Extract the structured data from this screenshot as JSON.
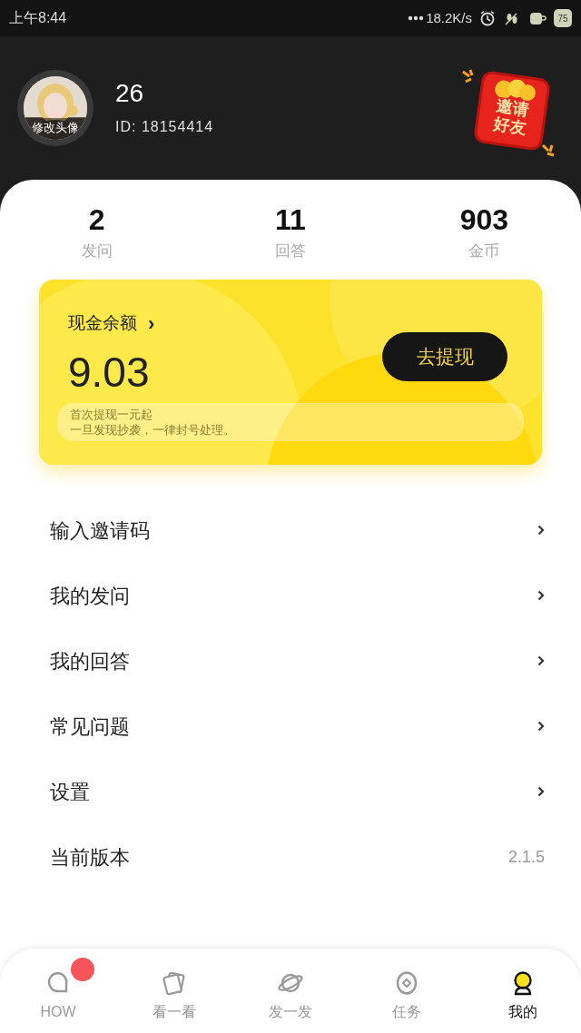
{
  "status_bar": {
    "time": "上午8:44",
    "network_speed": "18.2K/s",
    "battery": "75"
  },
  "profile": {
    "avatar_caption": "修改头像",
    "name": "26",
    "id": "ID: 18154414",
    "invite_button": "邀请好友"
  },
  "stats": [
    {
      "value": "2",
      "label": "发问"
    },
    {
      "value": "11",
      "label": "回答"
    },
    {
      "value": "903",
      "label": "金币"
    }
  ],
  "cash_card": {
    "title": "现金余额",
    "chevron": "›",
    "amount": "9.03",
    "withdraw_button": "去提现",
    "notices": [
      "首次提现一元起",
      "一旦发现抄袭，一律封号处理。"
    ]
  },
  "menu": [
    {
      "label": "输入邀请码",
      "kind": "link"
    },
    {
      "label": "我的发问",
      "kind": "link"
    },
    {
      "label": "我的回答",
      "kind": "link"
    },
    {
      "label": "常见问题",
      "kind": "link"
    },
    {
      "label": "设置",
      "kind": "link"
    },
    {
      "label": "当前版本",
      "kind": "value",
      "value": "2.1.5"
    }
  ],
  "tab_bar": [
    {
      "label": "HOW",
      "kind": "chat",
      "selected": false,
      "badge": true
    },
    {
      "label": "看一看",
      "kind": "cards",
      "selected": false,
      "badge": false
    },
    {
      "label": "发一发",
      "kind": "planet",
      "selected": false,
      "badge": false
    },
    {
      "label": "任务",
      "kind": "coin",
      "selected": false,
      "badge": false
    },
    {
      "label": "我的",
      "kind": "person",
      "selected": true,
      "badge": false
    }
  ]
}
